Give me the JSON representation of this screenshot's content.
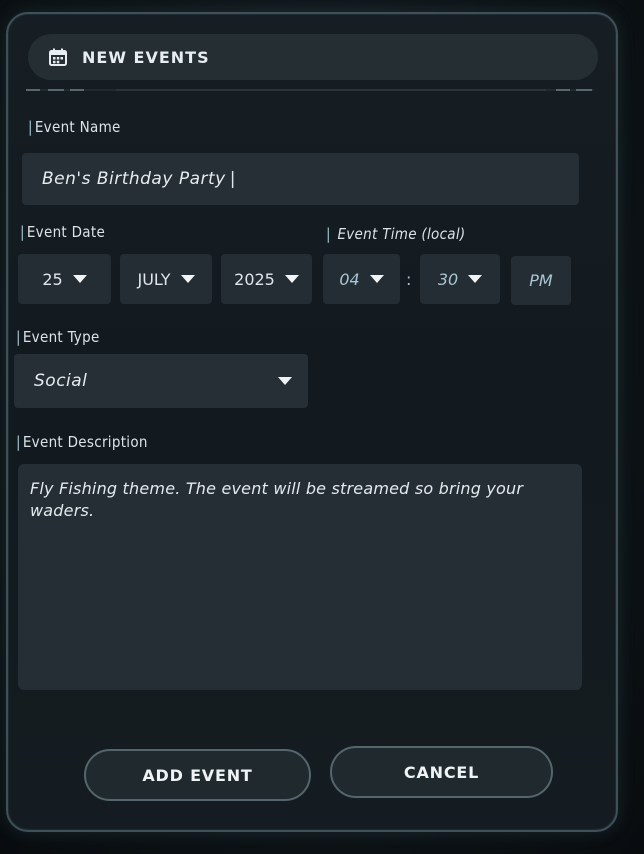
{
  "header": {
    "title": "NEW EVENTS",
    "icon": "calendar-icon"
  },
  "form": {
    "event_name": {
      "label": "Event Name",
      "value": "Ben's Birthday Party"
    },
    "event_date": {
      "label": "Event Date",
      "day": "25",
      "month": "JULY",
      "year": "2025"
    },
    "event_time": {
      "label": "Event Time (local)",
      "hour": "04",
      "separator": ":",
      "minute": "30",
      "ampm": "PM"
    },
    "event_type": {
      "label": "Event Type",
      "value": "Social"
    },
    "event_description": {
      "label": "Event Description",
      "value": "Fly Fishing theme. The event will be streamed so bring your waders."
    }
  },
  "actions": {
    "add_label": "ADD EVENT",
    "cancel_label": "CANCEL"
  },
  "colors": {
    "accent": "#9fc7d2",
    "field_bg": "#262f35",
    "panel_border": "#3e5058"
  }
}
